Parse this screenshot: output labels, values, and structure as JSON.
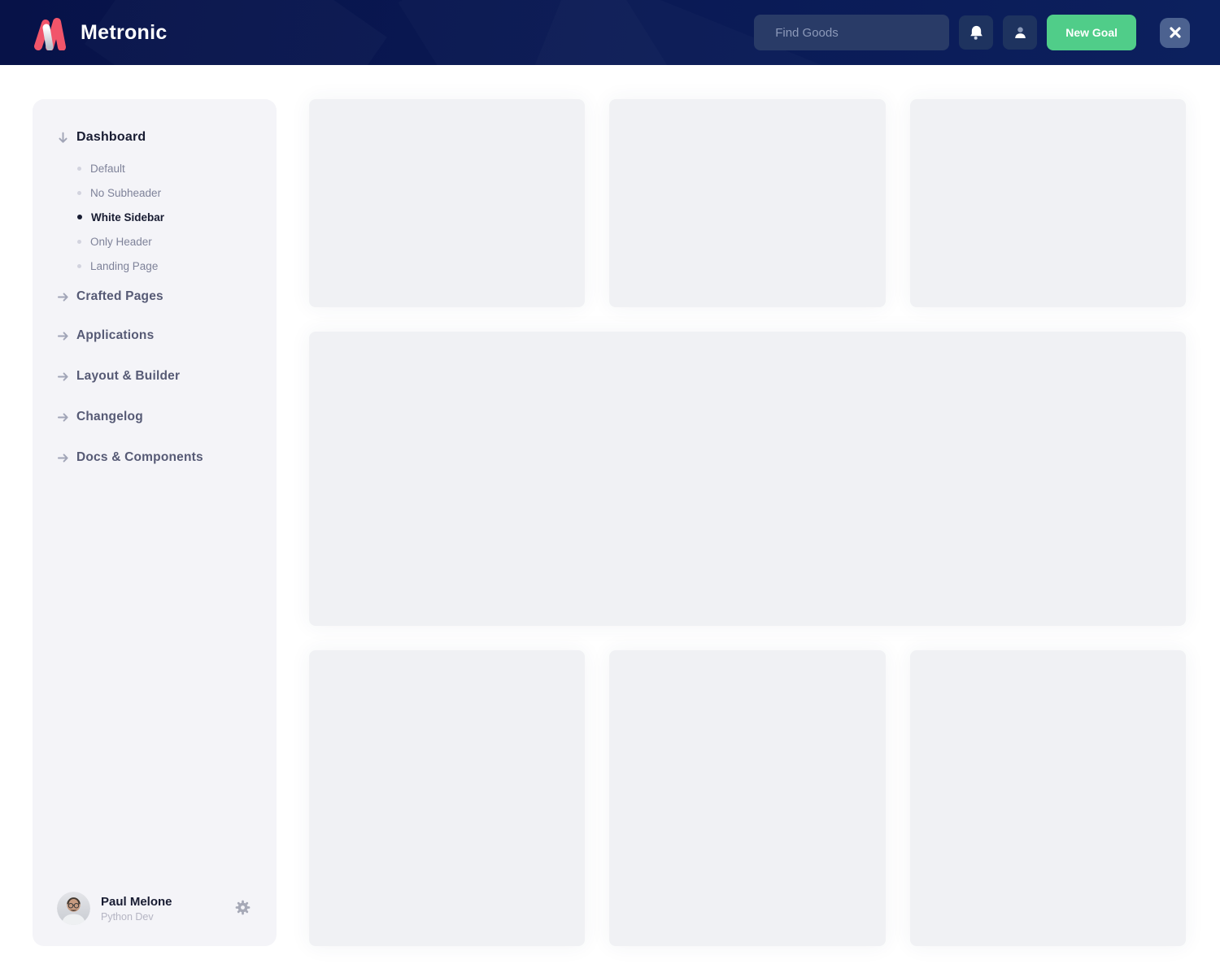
{
  "header": {
    "brand": "Metronic",
    "search_placeholder": "Find Goods",
    "new_goal_label": "New Goal",
    "icons": {
      "search": "magnifier-icon",
      "notifications": "bell-icon",
      "account": "person-icon",
      "close": "x-icon"
    },
    "colors": {
      "navy": "#0a1a55",
      "green": "#50cd89",
      "logo_red": "#f1556a"
    }
  },
  "sidebar": {
    "colors": {
      "background": "#f4f4f8",
      "active_text": "#181c32",
      "muted_text": "#7e8299"
    },
    "sections": [
      {
        "label": "Dashboard",
        "icon": "arrow-down",
        "expanded": true,
        "children": [
          {
            "label": "Default",
            "active": false
          },
          {
            "label": "No Subheader",
            "active": false
          },
          {
            "label": "White Sidebar",
            "active": true
          },
          {
            "label": "Only Header",
            "active": false
          },
          {
            "label": "Landing Page",
            "active": false
          }
        ]
      },
      {
        "label": "Crafted Pages",
        "icon": "arrow-right",
        "expanded": false
      },
      {
        "label": "Applications",
        "icon": "arrow-right",
        "expanded": false
      },
      {
        "label": "Layout & Builder",
        "icon": "arrow-right",
        "expanded": false
      },
      {
        "label": "Changelog",
        "icon": "arrow-right",
        "expanded": false
      },
      {
        "label": "Docs & Components",
        "icon": "arrow-right",
        "expanded": false
      }
    ],
    "user": {
      "name": "Paul Melone",
      "role": "Python Dev",
      "settings_icon": "gear-icon"
    }
  },
  "main": {
    "placeholder_cards": {
      "top_row": 3,
      "middle_row": 1,
      "bottom_row": 3
    },
    "card_color": "#f0f1f4"
  }
}
